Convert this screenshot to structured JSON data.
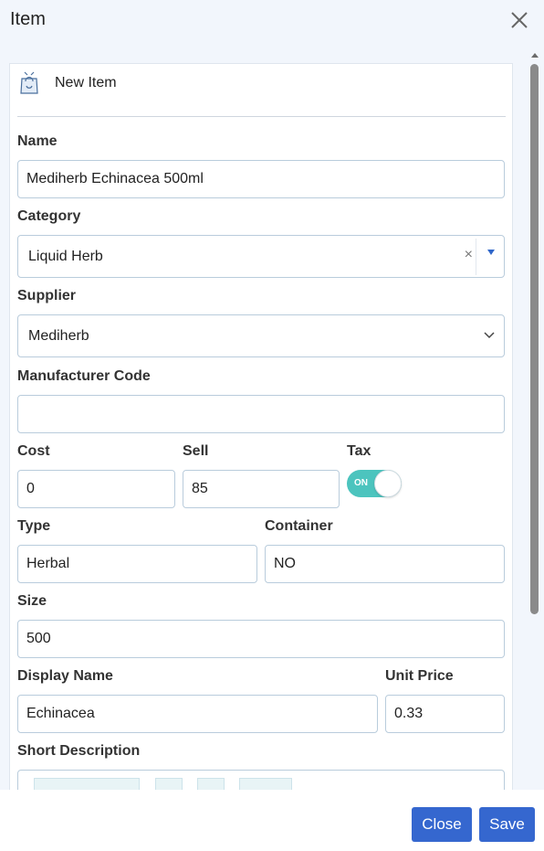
{
  "modal": {
    "title": "Item",
    "close_icon": "close-icon"
  },
  "card": {
    "title": "New Item",
    "icon": "shopping-bag-icon"
  },
  "form": {
    "name": {
      "label": "Name",
      "value": "Mediherb Echinacea 500ml"
    },
    "category": {
      "label": "Category",
      "value": "Liquid Herb",
      "clear_glyph": "×"
    },
    "supplier": {
      "label": "Supplier",
      "value": "Mediherb"
    },
    "manufacturer_code": {
      "label": "Manufacturer Code",
      "value": ""
    },
    "cost": {
      "label": "Cost",
      "value": "0"
    },
    "sell": {
      "label": "Sell",
      "value": "85"
    },
    "tax": {
      "label": "Tax",
      "toggle_text": "ON",
      "enabled": true,
      "on_color": "#4cc4be"
    },
    "type": {
      "label": "Type",
      "value": "Herbal"
    },
    "container": {
      "label": "Container",
      "value": "NO"
    },
    "size": {
      "label": "Size",
      "value": "500"
    },
    "display_name": {
      "label": "Display Name",
      "value": "Echinacea"
    },
    "unit_price": {
      "label": "Unit Price",
      "value": "0.33"
    },
    "short_description": {
      "label": "Short Description"
    }
  },
  "footer": {
    "close_label": "Close",
    "save_label": "Save",
    "button_color": "#3567cf"
  }
}
